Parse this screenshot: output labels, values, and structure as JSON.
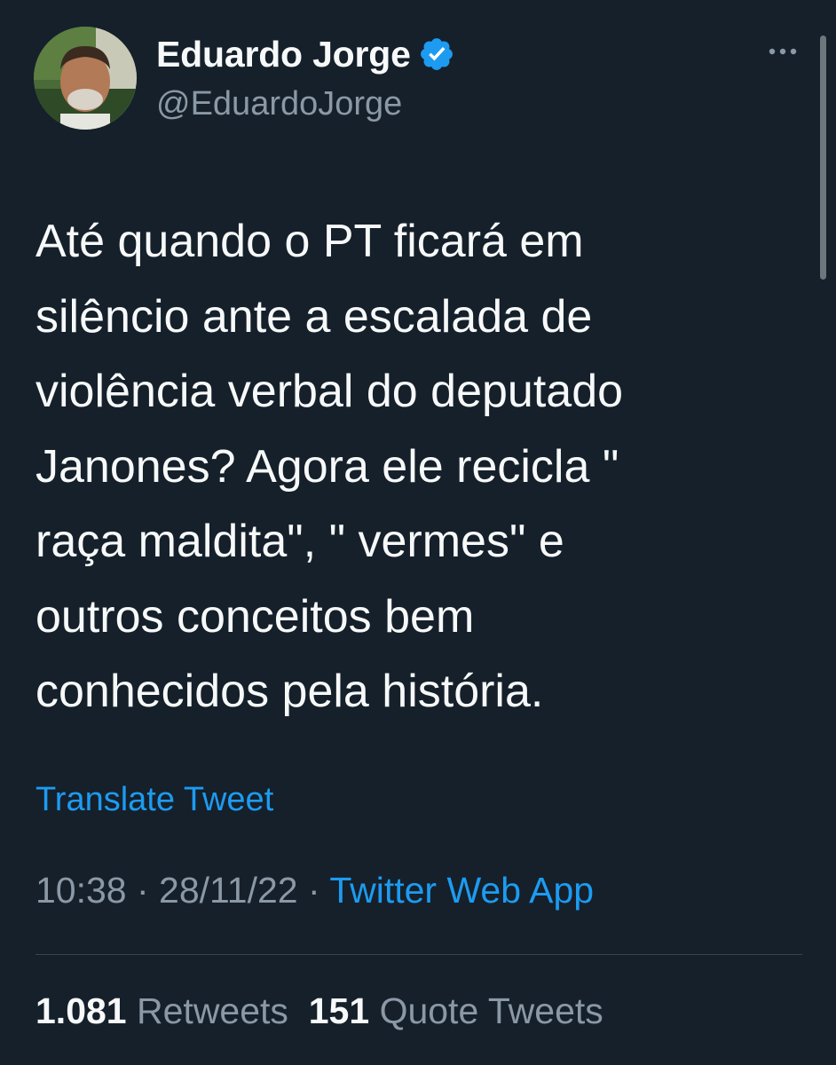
{
  "author": {
    "display_name": "Eduardo Jorge",
    "handle": "@EduardoJorge",
    "verified": true
  },
  "tweet": {
    "text": "Até quando o PT ficará em\nsilêncio ante a escalada de\nviolência verbal do deputado\nJanones? Agora ele recicla \"\nraça maldita\", \" vermes\" e\noutros conceitos bem\nconhecidos pela história.",
    "translate_label": "Translate Tweet",
    "time": "10:38",
    "date": "28/11/22",
    "separator": " · ",
    "source": "Twitter Web App"
  },
  "stats": {
    "retweets_count": "1.081",
    "retweets_label": "Retweets",
    "quotes_count": "151",
    "quotes_label": "Quote Tweets"
  },
  "colors": {
    "background": "#15202b",
    "text": "#f7f9f9",
    "muted": "#8b98a5",
    "accent": "#1d9bf0"
  },
  "icons": {
    "verified": "verified-badge-icon",
    "more": "more-horizontal-icon"
  }
}
